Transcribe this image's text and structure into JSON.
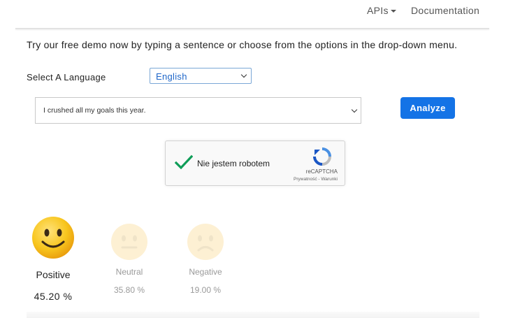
{
  "nav": {
    "apis_label": "APIs",
    "docs_label": "Documentation"
  },
  "intro_text": "Try our free demo now by typing a sentence or choose from the options in the drop-down menu.",
  "language": {
    "label": "Select A Language",
    "selected": "English"
  },
  "sentence": {
    "selected": "I crushed all my goals this year."
  },
  "analyze_label": "Analyze",
  "captcha": {
    "label": "Nie jestem robotem",
    "brand": "reCAPTCHA",
    "privacy": "Prywatność - Warunki",
    "checked": true
  },
  "results": {
    "positive": {
      "label": "Positive",
      "value": "45.20 %",
      "active": true
    },
    "neutral": {
      "label": "Neutral",
      "value": "35.80 %",
      "active": false
    },
    "negative": {
      "label": "Negative",
      "value": "19.00 %",
      "active": false
    }
  },
  "colors": {
    "accent": "#1473e6",
    "checkmark": "#0f9d58",
    "emoji_active": "#f5b716",
    "emoji_faded": "#fdf0d3"
  }
}
